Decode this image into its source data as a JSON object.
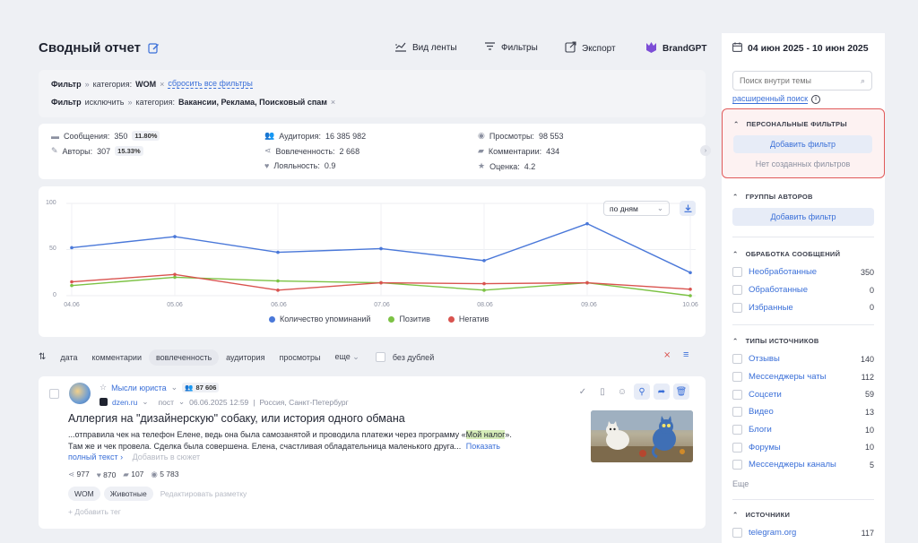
{
  "header": {
    "title": "Сводный отчет",
    "toolbar": {
      "feed_view": "Вид ленты",
      "filters": "Фильтры",
      "export": "Экспорт",
      "brandgpt": "BrandGPT"
    }
  },
  "filter": {
    "label": "Фильтр",
    "category_label": "категория:",
    "category_value": "WOM",
    "reset": "сбросить все фильтры",
    "exclude_label": "исключить",
    "exclude_value": "Вакансии, Реклама, Поисковый спам"
  },
  "stats": {
    "messages_label": "Сообщения:",
    "messages_value": "350",
    "messages_badge": "11.80%",
    "authors_label": "Авторы:",
    "authors_value": "307",
    "authors_badge": "15.33%",
    "audience_label": "Аудитория:",
    "audience_value": "16 385 982",
    "engagement_label": "Вовлеченность:",
    "engagement_value": "2 668",
    "loyalty_label": "Лояльность:",
    "loyalty_value": "0.9",
    "views_label": "Просмотры:",
    "views_value": "98 553",
    "comments_label": "Комментарии:",
    "comments_value": "434",
    "rating_label": "Оценка:",
    "rating_value": "4.2"
  },
  "chart_controls": {
    "period": "по дням"
  },
  "chart_data": {
    "type": "line",
    "x": [
      "04.06",
      "05.06",
      "06.06",
      "07.06",
      "08.06",
      "09.06",
      "10.06"
    ],
    "ylim": [
      0,
      100
    ],
    "yticks": [
      "100",
      "50",
      "0"
    ],
    "grid": true,
    "legend_position": "bottom",
    "series": [
      {
        "name": "Количество упоминаний",
        "color": "#4a78d9",
        "values": [
          52,
          64,
          47,
          51,
          38,
          78,
          25
        ]
      },
      {
        "name": "Позитив",
        "color": "#7cc244",
        "values": [
          11,
          20,
          16,
          14,
          6,
          14,
          0
        ]
      },
      {
        "name": "Негатив",
        "color": "#d9534f",
        "values": [
          15,
          23,
          6,
          14,
          13,
          14,
          7
        ]
      }
    ]
  },
  "sort": {
    "items": [
      "дата",
      "комментарии",
      "вовлеченность",
      "аудитория",
      "просмотры",
      "еще"
    ],
    "no_duplicates": "без дублей"
  },
  "post": {
    "author": "Мысли юриста",
    "audience": "87 606",
    "source": "dzen.ru",
    "type": "пост",
    "datetime": "06.06.2025 12:59",
    "location": "Россия, Санкт-Петербург",
    "title": "Аллергия на \"дизайнерскую\" собаку, или история одного обмана",
    "text_before": "...отправила чек на телефон Елене, ведь она была самозанятой и проводила платежи через программу «",
    "highlight": "Мой налог",
    "text_after": "». Там же и чек провела. Сделка была совершена. Елена, счастливая обладательница маленького друга...",
    "show_full": "Показать полный текст ›",
    "add_to_story": "Добавить в сюжет",
    "reposts": "977",
    "likes": "870",
    "comments": "107",
    "views": "5 783",
    "tags": [
      "WOM",
      "Животные"
    ],
    "edit_markup": "Редактировать разметку",
    "add_tag": "+ Добавить тег"
  },
  "sidebar": {
    "date_range": "04 июн 2025 - 10 июн 2025",
    "search_placeholder": "Поиск внутри темы",
    "advanced_search": "расширенный поиск",
    "personal_filters": {
      "title": "ПЕРСОНАЛЬНЫЕ ФИЛЬТРЫ",
      "add": "Добавить фильтр",
      "empty": "Нет созданных фильтров"
    },
    "author_groups": {
      "title": "ГРУППЫ АВТОРОВ",
      "add": "Добавить фильтр"
    },
    "processing": {
      "title": "ОБРАБОТКА СООБЩЕНИЙ",
      "items": [
        {
          "label": "Необработанные",
          "count": "350"
        },
        {
          "label": "Обработанные",
          "count": "0"
        },
        {
          "label": "Избранные",
          "count": "0"
        }
      ]
    },
    "source_types": {
      "title": "ТИПЫ ИСТОЧНИКОВ",
      "items": [
        {
          "label": "Отзывы",
          "count": "140"
        },
        {
          "label": "Мессенджеры чаты",
          "count": "112"
        },
        {
          "label": "Соцсети",
          "count": "59"
        },
        {
          "label": "Видео",
          "count": "13"
        },
        {
          "label": "Блоги",
          "count": "10"
        },
        {
          "label": "Форумы",
          "count": "10"
        },
        {
          "label": "Мессенджеры каналы",
          "count": "5"
        }
      ],
      "more": "Еще"
    },
    "sources": {
      "title": "ИСТОЧНИКИ",
      "items": [
        {
          "label": "telegram.org",
          "count": "117"
        }
      ]
    }
  },
  "colors": {
    "accent": "#3a6fd8",
    "highlight_box": "#e05a5a",
    "text_highlight": "#d6ecb8"
  }
}
